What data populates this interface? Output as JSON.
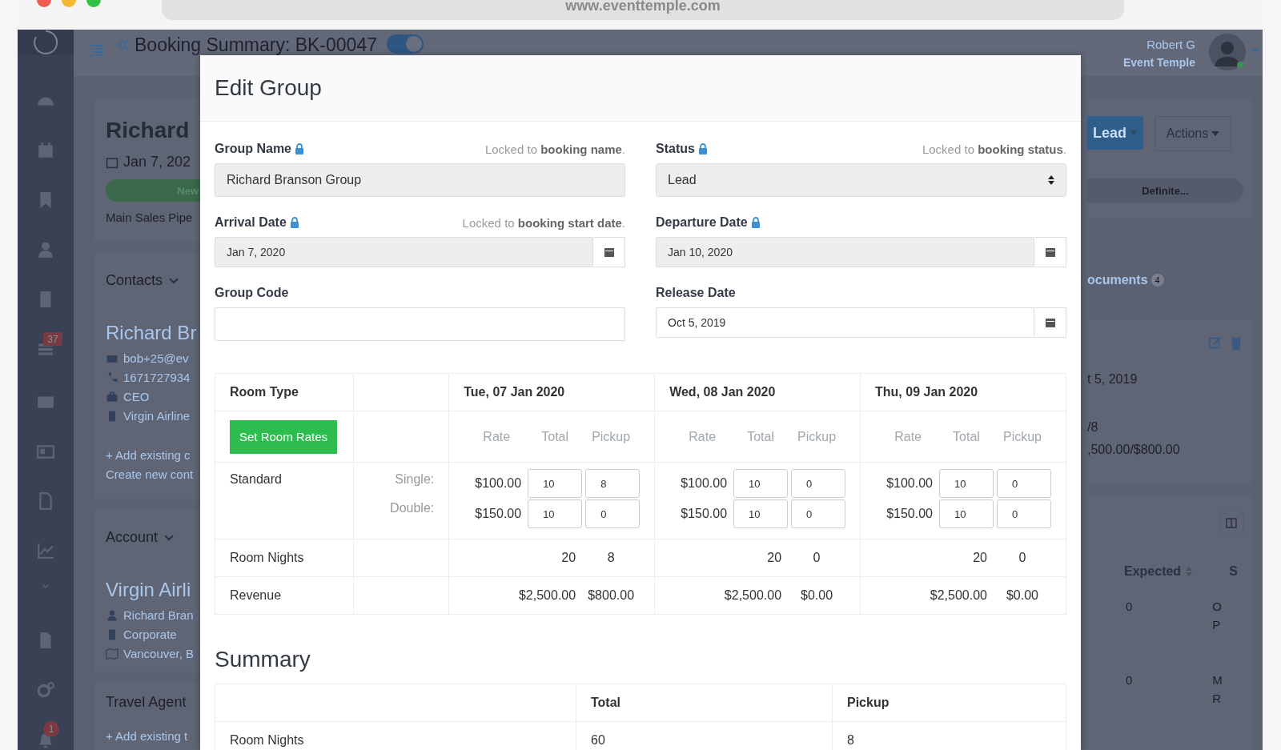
{
  "browser": {
    "url": "www.eventtemple.com"
  },
  "header": {
    "title": "Booking Summary: BK-00047",
    "toggle": {
      "on": true
    },
    "user_name": "Robert G",
    "user_org": "Event Temple"
  },
  "sidebar": {
    "messages_badge": "37",
    "notifications_badge": "1"
  },
  "background": {
    "booking": {
      "name": "Richard",
      "date": "Jan 7, 202",
      "stage": "New",
      "pipeline": "Main Sales Pipe"
    },
    "contacts": {
      "heading": "Contacts",
      "name": "Richard Br",
      "email": "bob+25@ev",
      "phone": "1671727934",
      "title": "CEO",
      "company": "Virgin Airline",
      "add_link": "+ Add existing c",
      "create_link": "Create new cont"
    },
    "account": {
      "heading": "Account",
      "name": "Virgin Airli",
      "contact": "Richard Bran",
      "type": "Corporate",
      "location": "Vancouver, B"
    },
    "travel_agent": {
      "heading": "Travel Agent",
      "add_link": "+ Add existing t"
    },
    "right": {
      "status_button": "Lead",
      "actions_button": "Actions",
      "next_stage": "Definite...",
      "documents": "ocuments",
      "documents_count": "4",
      "date": "t 5, 2019",
      "pickup": "/8",
      "revenue": ",500.00/$800.00",
      "expected_header": "Expected",
      "column_cut": "S",
      "rows": [
        {
          "expected": "0",
          "note": [
            "O",
            "P"
          ]
        },
        {
          "expected": "0",
          "note": [
            "M",
            "R"
          ]
        }
      ]
    }
  },
  "modal": {
    "title": "Edit Group",
    "fields": [
      {
        "label": "Group Name",
        "kind": "text",
        "locked": true,
        "note": "Locked to **booking name**.",
        "value": "Richard Branson Group"
      },
      {
        "label": "Status",
        "kind": "select",
        "locked": true,
        "note": "Locked to **booking status**.",
        "value": "Lead"
      },
      {
        "label": "Arrival Date",
        "kind": "date",
        "locked": true,
        "note": "Locked to **booking start date**.",
        "value": "Jan 7, 2020"
      },
      {
        "label": "Departure Date",
        "kind": "date",
        "locked": true,
        "value": "Jan 10, 2020"
      },
      {
        "label": "Group Code",
        "kind": "text",
        "locked": false
      },
      {
        "label": "Release Date",
        "kind": "date",
        "locked": false,
        "value": "Oct 5, 2019"
      }
    ],
    "rates": {
      "room_type_header": "Room Type",
      "set_rates_button": "Set Room Rates",
      "room_type": "Standard",
      "occupancies": [
        "Single:",
        "Double:"
      ],
      "room_nights_label": "Room Nights",
      "revenue_label": "Revenue",
      "days": [
        {
          "date": "Tue, 07 Jan 2020",
          "subheaders": [
            "Rate",
            "Total",
            "Pickup"
          ],
          "lines": [
            {
              "rate": "$100.00",
              "total": "10",
              "pickup": "8"
            },
            {
              "rate": "$150.00",
              "total": "10",
              "pickup": "0"
            }
          ],
          "room_nights": [
            "20",
            "8"
          ],
          "revenue": [
            "$2,500.00",
            "$800.00"
          ]
        },
        {
          "date": "Wed, 08 Jan 2020",
          "subheaders": [
            "Rate",
            "Total",
            "Pickup"
          ],
          "lines": [
            {
              "rate": "$100.00",
              "total": "10",
              "pickup": "0"
            },
            {
              "rate": "$150.00",
              "total": "10",
              "pickup": "0"
            }
          ],
          "room_nights": [
            "20",
            "0"
          ],
          "revenue": [
            "$2,500.00",
            "$0.00"
          ]
        },
        {
          "date": "Thu, 09 Jan 2020",
          "subheaders": [
            "Rate",
            "Total",
            "Pickup"
          ],
          "lines": [
            {
              "rate": "$100.00",
              "total": "10",
              "pickup": "0"
            },
            {
              "rate": "$150.00",
              "total": "10",
              "pickup": "0"
            }
          ],
          "room_nights": [
            "20",
            "0"
          ],
          "revenue": [
            "$2,500.00",
            "$0.00"
          ]
        }
      ]
    },
    "summary": {
      "title": "Summary",
      "columns": [
        "Total",
        "Pickup"
      ],
      "rows": [
        {
          "label": "Room Nights",
          "total": "60",
          "pickup": "8"
        }
      ]
    }
  }
}
